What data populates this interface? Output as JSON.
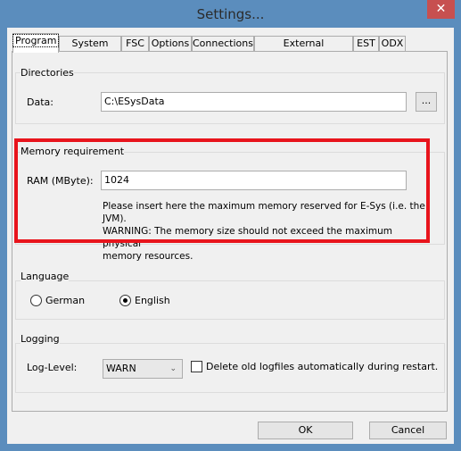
{
  "window": {
    "title": "Settings...",
    "close_icon": "close-icon"
  },
  "tabs": [
    "Program",
    "System data",
    "FSC",
    "Options",
    "Connections",
    "External Applications",
    "EST",
    "ODX"
  ],
  "directories": {
    "title": "Directories",
    "data_label": "Data:",
    "data_value": "C:\\ESysData",
    "browse_label": "..."
  },
  "memory": {
    "title": "Memory requirement",
    "ram_label": "RAM (MByte):",
    "ram_value": "1024",
    "hint_lines": [
      "Please insert here the maximum memory reserved for E-Sys (i.e. the JVM).",
      "WARNING: The memory size should not exceed the maximum physical",
      "memory resources."
    ],
    "highlight_color": "#e8141c"
  },
  "language": {
    "title": "Language",
    "options": [
      "German",
      "English"
    ],
    "selected": "English"
  },
  "logging": {
    "title": "Logging",
    "level_label": "Log-Level:",
    "level_value": "WARN",
    "delete_label": "Delete old logfiles automatically during restart.",
    "delete_checked": false
  },
  "buttons": {
    "ok": "OK",
    "cancel": "Cancel"
  }
}
